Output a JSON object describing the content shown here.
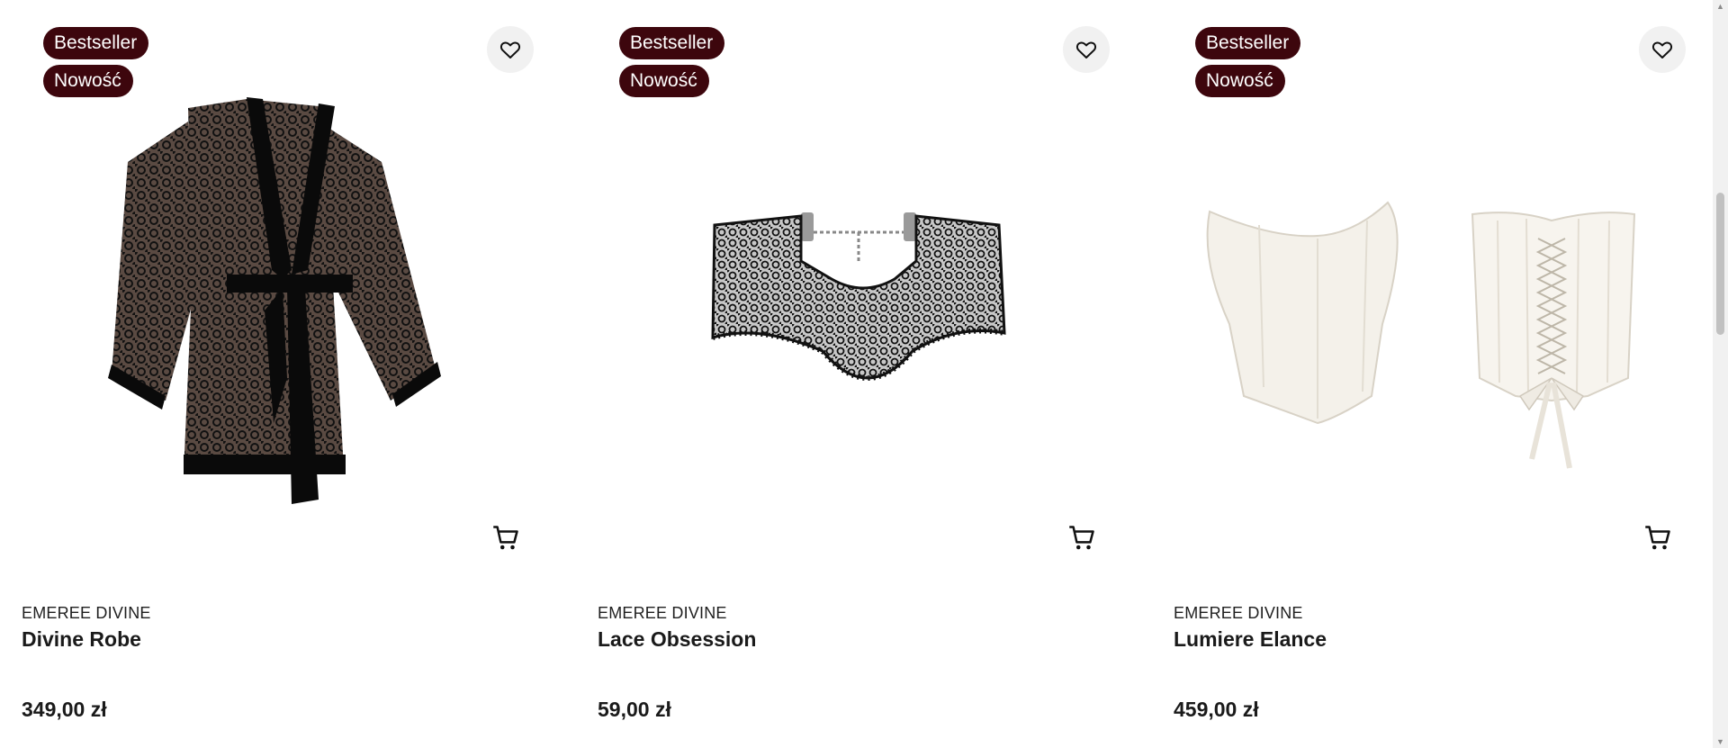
{
  "products": [
    {
      "badges": [
        "Bestseller",
        "Nowość"
      ],
      "brand": "EMEREE DIVINE",
      "name": "Divine Robe",
      "price": "349,00 zł",
      "image_icon": "lace-robe-image"
    },
    {
      "badges": [
        "Bestseller",
        "Nowość"
      ],
      "brand": "EMEREE DIVINE",
      "name": "Lace Obsession",
      "price": "59,00 zł",
      "image_icon": "lace-choker-image"
    },
    {
      "badges": [
        "Bestseller",
        "Nowość"
      ],
      "brand": "EMEREE DIVINE",
      "name": "Lumiere Elance",
      "price": "459,00 zł",
      "image_icon": "white-corset-image"
    }
  ],
  "icons": {
    "wishlist": "heart-icon",
    "cart": "cart-icon"
  },
  "colors": {
    "badge_bg": "#3d060d",
    "wish_bg": "#f1f1f1",
    "text": "#1a1a1a"
  }
}
